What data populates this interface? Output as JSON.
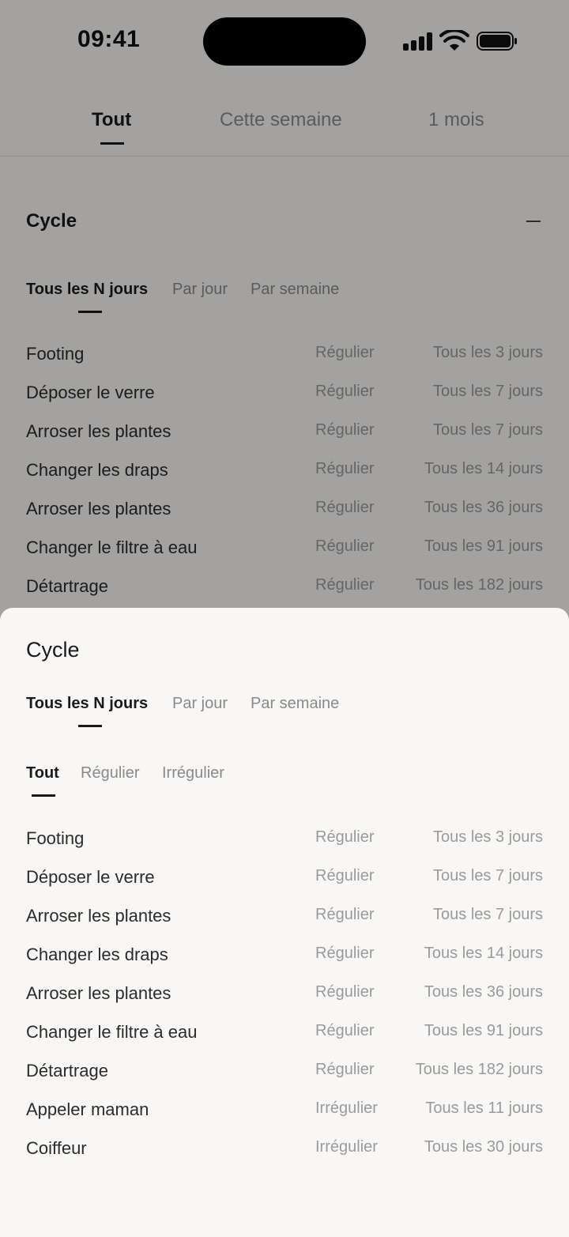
{
  "status_bar": {
    "time": "09:41"
  },
  "top_tabs": [
    {
      "label": "Tout",
      "active": true
    },
    {
      "label": "Cette semaine",
      "active": false
    },
    {
      "label": "1 mois",
      "active": false
    }
  ],
  "background": {
    "section_title": "Cycle",
    "mode_tabs": [
      "Tous les N jours",
      "Par jour",
      "Par semaine"
    ],
    "rows": [
      {
        "name": "Footing",
        "type": "Régulier",
        "frequency": "Tous les 3 jours"
      },
      {
        "name": "Déposer le verre",
        "type": "Régulier",
        "frequency": "Tous les 7 jours"
      },
      {
        "name": "Arroser les plantes",
        "type": "Régulier",
        "frequency": "Tous les 7 jours"
      },
      {
        "name": "Changer les draps",
        "type": "Régulier",
        "frequency": "Tous les 14 jours"
      },
      {
        "name": "Arroser les plantes",
        "type": "Régulier",
        "frequency": "Tous les 36 jours"
      },
      {
        "name": "Changer le filtre à eau",
        "type": "Régulier",
        "frequency": "Tous les 91 jours"
      },
      {
        "name": "Détartrage",
        "type": "Régulier",
        "frequency": "Tous les 182 jours"
      }
    ]
  },
  "sheet": {
    "title": "Cycle",
    "mode_tabs": [
      "Tous les N jours",
      "Par jour",
      "Par semaine"
    ],
    "filter_tabs": [
      "Tout",
      "Régulier",
      "Irrégulier"
    ],
    "rows": [
      {
        "name": "Footing",
        "type": "Régulier",
        "frequency": "Tous les 3 jours"
      },
      {
        "name": "Déposer le verre",
        "type": "Régulier",
        "frequency": "Tous les 7 jours"
      },
      {
        "name": "Arroser les plantes",
        "type": "Régulier",
        "frequency": "Tous les 7 jours"
      },
      {
        "name": "Changer les draps",
        "type": "Régulier",
        "frequency": "Tous les 14 jours"
      },
      {
        "name": "Arroser les plantes",
        "type": "Régulier",
        "frequency": "Tous les 36 jours"
      },
      {
        "name": "Changer le filtre à eau",
        "type": "Régulier",
        "frequency": "Tous les 91 jours"
      },
      {
        "name": "Détartrage",
        "type": "Régulier",
        "frequency": "Tous les 182 jours"
      },
      {
        "name": "Appeler maman",
        "type": "Irrégulier",
        "frequency": "Tous les 11 jours"
      },
      {
        "name": "Coiffeur",
        "type": "Irrégulier",
        "frequency": "Tous les 30 jours"
      }
    ]
  }
}
